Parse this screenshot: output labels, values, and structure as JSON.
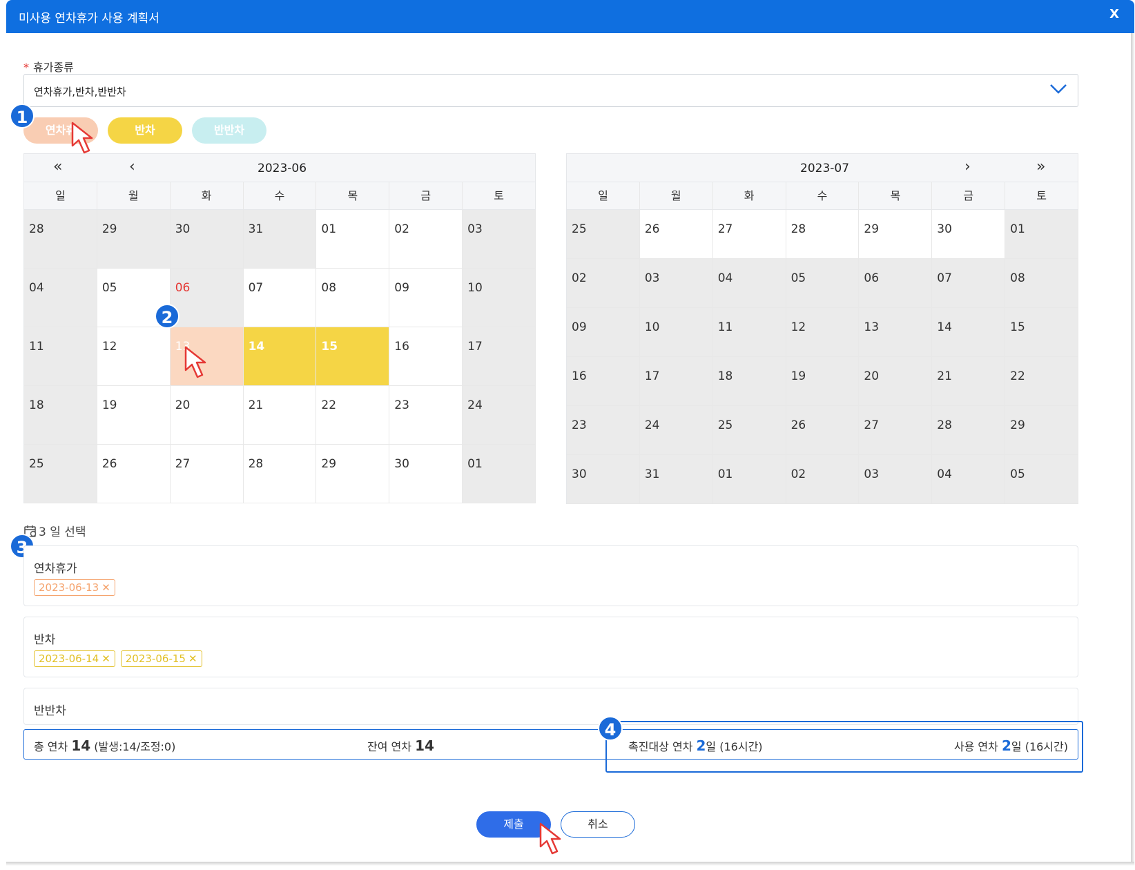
{
  "dialog": {
    "title": "미사용 연차휴가 사용 계획서",
    "close_label": "X"
  },
  "leave_type": {
    "label": "휴가종류",
    "required_mark": "*",
    "value": "연차휴가,반차,반반차",
    "pills": [
      "연차휴",
      "반차",
      "반반차"
    ]
  },
  "steps": [
    "1",
    "2",
    "3",
    "4"
  ],
  "calendar_left": {
    "month": "2023-06",
    "nav_prev_year": "«",
    "nav_prev": "‹",
    "weekdays": [
      "일",
      "월",
      "화",
      "수",
      "목",
      "금",
      "토"
    ],
    "days": [
      "28",
      "29",
      "30",
      "31",
      "01",
      "02",
      "03",
      "04",
      "05",
      "06",
      "07",
      "08",
      "09",
      "10",
      "11",
      "12",
      "13",
      "14",
      "15",
      "16",
      "17",
      "18",
      "19",
      "20",
      "21",
      "22",
      "23",
      "24",
      "25",
      "26",
      "27",
      "28",
      "29",
      "30",
      "01"
    ]
  },
  "calendar_right": {
    "month": "2023-07",
    "nav_next": "›",
    "nav_next_year": "»",
    "weekdays": [
      "일",
      "월",
      "화",
      "수",
      "목",
      "금",
      "토"
    ],
    "days": [
      "25",
      "26",
      "27",
      "28",
      "29",
      "30",
      "01",
      "02",
      "03",
      "04",
      "05",
      "06",
      "07",
      "08",
      "09",
      "10",
      "11",
      "12",
      "13",
      "14",
      "15",
      "16",
      "17",
      "18",
      "19",
      "20",
      "21",
      "22",
      "23",
      "24",
      "25",
      "26",
      "27",
      "28",
      "29",
      "30",
      "31",
      "01",
      "02",
      "03",
      "04",
      "05"
    ]
  },
  "selection": {
    "count": "3",
    "count_label": "일 선택",
    "groups": [
      {
        "title": "연차휴가",
        "tags": [
          "2023-06-13"
        ]
      },
      {
        "title": "반차",
        "tags": [
          "2023-06-14",
          "2023-06-15"
        ]
      },
      {
        "title": "반반차",
        "tags": []
      }
    ],
    "remove_glyph": "✕"
  },
  "summary": {
    "total_label": "총 연차",
    "total_value": "14",
    "total_detail": "(발생:14/조정:0)",
    "remaining_label": "잔여 연차",
    "remaining_value": "14",
    "promo_label": "촉진대상 연차",
    "promo_value": "2",
    "promo_unit": "일",
    "promo_detail": "(16시간)",
    "used_label": "사용 연차",
    "used_value": "2",
    "used_unit": "일",
    "used_detail": "(16시간)"
  },
  "buttons": {
    "submit": "제출",
    "cancel": "취소"
  },
  "colors": {
    "primary": "#0f6fe0",
    "annual": "#f9cdb3",
    "half": "#f5d545",
    "quarter": "#c8eef0",
    "holiday": "#e53935"
  }
}
